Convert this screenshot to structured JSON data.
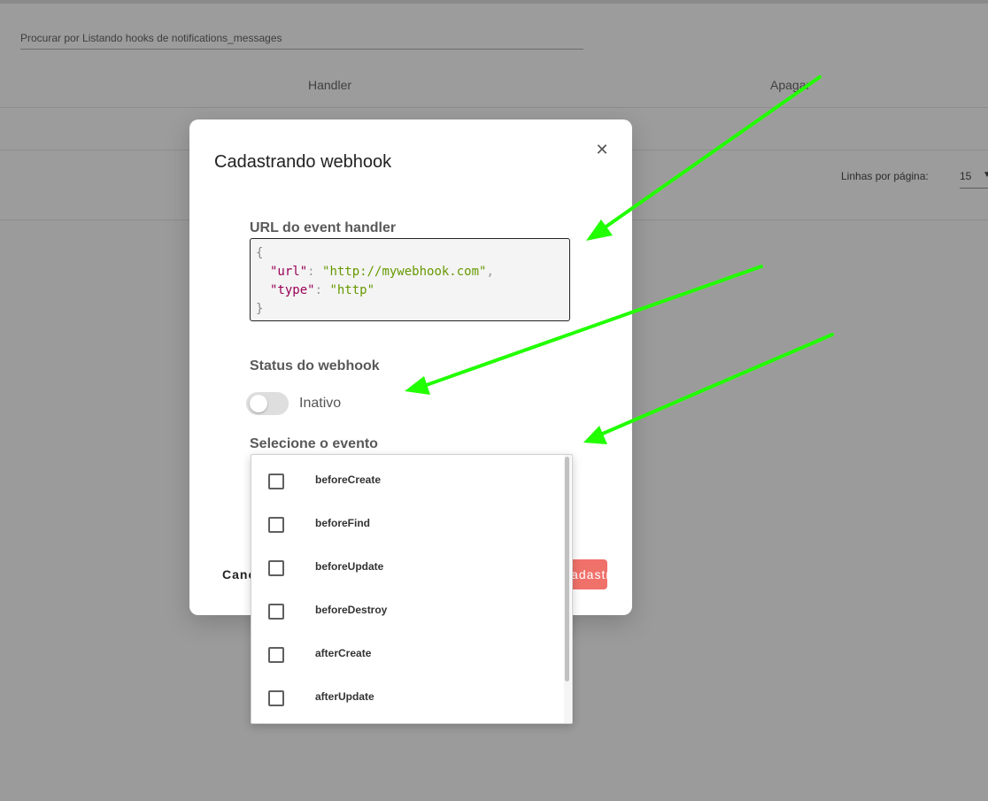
{
  "background": {
    "search_placeholder": "Procurar por Listando hooks de notifications_messages",
    "columns": [
      "Handler",
      "Apagar"
    ],
    "rows_per_page_label": "Linhas por página:",
    "rows_per_page_value": "15"
  },
  "modal": {
    "title": "Cadastrando webhook",
    "url_label": "URL do event handler",
    "code": {
      "open": "{",
      "close": "}",
      "url_key": "\"url\"",
      "url_value": "\"http://mywebhook.com\"",
      "type_key": "\"type\"",
      "type_value": "\"http\""
    },
    "status_label": "Status do webhook",
    "status_value": "Inativo",
    "event_label": "Selecione o evento",
    "cancel_label": "Cancelar",
    "submit_label": "Cadastrar"
  },
  "dropdown": {
    "options": [
      "beforeCreate",
      "beforeFind",
      "beforeUpdate",
      "beforeDestroy",
      "afterCreate",
      "afterUpdate"
    ]
  },
  "colors": {
    "accent": "#f0716a",
    "annotation_arrow": "#22ff00"
  }
}
